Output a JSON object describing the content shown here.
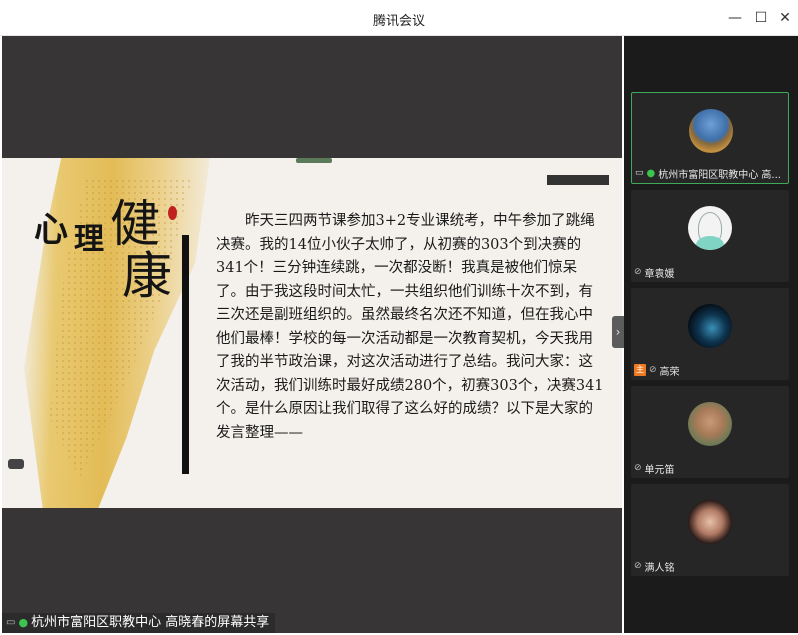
{
  "window": {
    "title": "腾讯会议",
    "minimize_icon": "—",
    "maximize_icon": "☐",
    "close_icon": "✕"
  },
  "slide": {
    "heading_chars": [
      "心",
      "理",
      "健",
      "康"
    ],
    "paragraph": "昨天三四两节课参加3+2专业课统考，中午参加了跳绳决赛。我的14位小伙子太帅了，从初赛的303个到决赛的341个！三分钟连续跳，一次都没断！我真是被他们惊呆了。由于我这段时间太忙，一共组织他们训练十次不到，有三次还是副班组织的。虽然最终名次还不知道，但在我心中他们最棒！学校的每一次活动都是一次教育契机，今天我用了我的半节政治课，对这次活动进行了总结。我问大家：这次活动，我们训练时最好成绩280个，初赛303个，决赛341个。是什么原因让我们取得了这么好的成绩？以下是大家的发言整理——"
  },
  "share_caption": "杭州市富阳区职教中心 高晓春的屏幕共享",
  "expand_icon": "›",
  "participants": [
    {
      "name": "杭州市富阳区职教中心 高...",
      "avatar_icon": "landscape-avatar",
      "mic": "on",
      "screen_share": true,
      "host": false
    },
    {
      "name": "章袁媛",
      "avatar_icon": "cartoon-girl-avatar",
      "mic": "off",
      "screen_share": false,
      "host": false
    },
    {
      "name": "高荣",
      "avatar_icon": "dark-water-avatar",
      "mic": "off",
      "screen_share": false,
      "host": true,
      "host_badge": "主"
    },
    {
      "name": "单元笛",
      "avatar_icon": "person-photo-avatar",
      "mic": "off",
      "screen_share": false,
      "host": false
    },
    {
      "name": "满人铭",
      "avatar_icon": "selfie-avatar",
      "mic": "off",
      "screen_share": false,
      "host": false
    }
  ],
  "colors": {
    "share_bg": "#373535",
    "panel_bg": "#1b1b1b",
    "tile_bg": "#262626",
    "active_border": "#3fa85a",
    "mic_on": "#3cc44f",
    "host_badge": "#ef7a22",
    "seal_red": "#c0211e"
  }
}
